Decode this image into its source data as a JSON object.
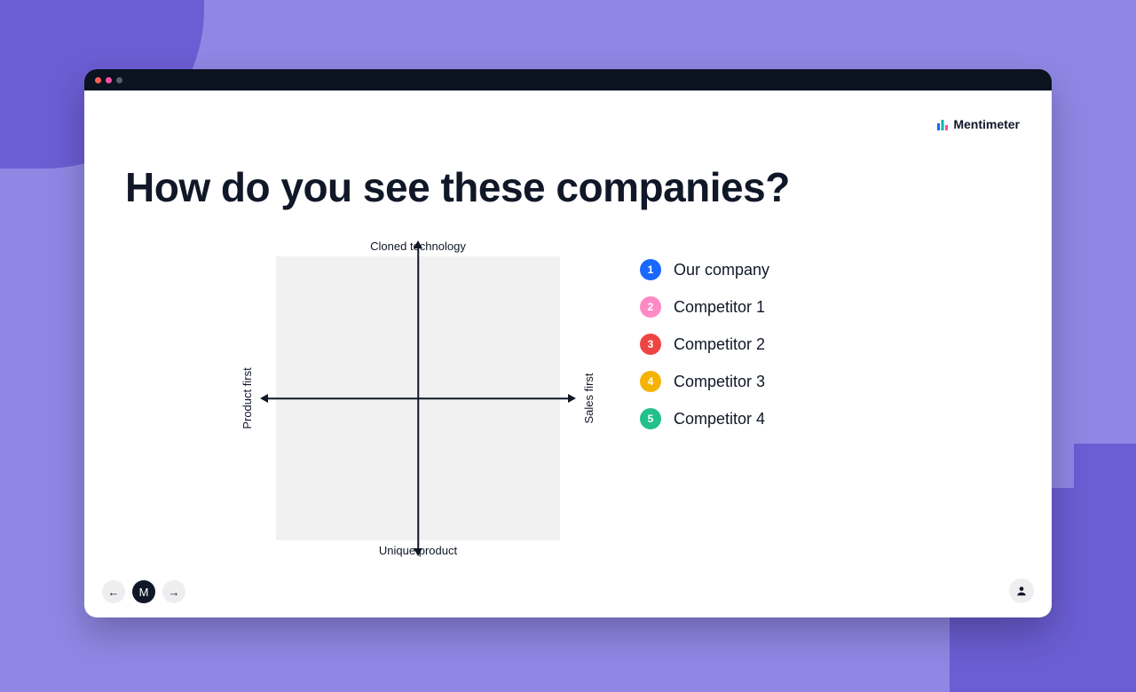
{
  "brand": {
    "name": "Mentimeter"
  },
  "title": "How do you see these companies?",
  "axes": {
    "top": "Cloned technology",
    "bottom": "Unique product",
    "left": "Product first",
    "right": "Sales first"
  },
  "legend": [
    {
      "num": "1",
      "label": "Our company",
      "color": "#1968ff"
    },
    {
      "num": "2",
      "label": "Competitor 1",
      "color": "#ff8ac5"
    },
    {
      "num": "3",
      "label": "Competitor 2",
      "color": "#ef4444"
    },
    {
      "num": "4",
      "label": "Competitor 3",
      "color": "#f5b301"
    },
    {
      "num": "5",
      "label": "Competitor 4",
      "color": "#22c08b"
    }
  ],
  "nav": {
    "prev": "←",
    "logo": "M",
    "next": "→"
  }
}
